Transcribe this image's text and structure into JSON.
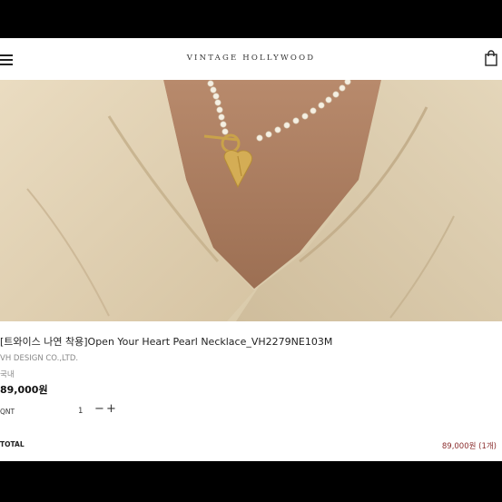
{
  "header": {
    "brand": "VINTAGE HOLLYWOOD",
    "menu_icon": "hamburger-menu-icon",
    "cart_icon": "shopping-bag-icon"
  },
  "hero": {
    "image": "model-wearing-pearl-heart-necklace"
  },
  "product": {
    "title": "[트와이스 나연 착용]Open Your Heart Pearl Necklace_VH2279NE103M",
    "brand": "VH DESIGN CO.,LTD.",
    "origin": "국내",
    "price": "89,000원"
  },
  "quantity": {
    "label": "QNT",
    "value": "1",
    "minus": "−",
    "plus": "+"
  },
  "total": {
    "label": "TOTAL",
    "value": "89,000원 (1개)"
  },
  "colors": {
    "price_accent": "#8b2e2e",
    "frame": "#000000"
  }
}
